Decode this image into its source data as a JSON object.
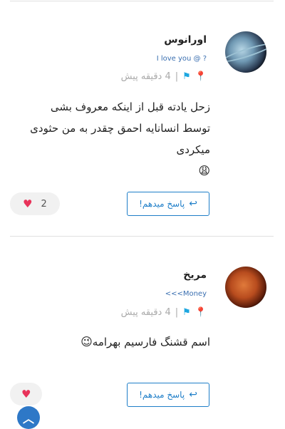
{
  "comments": [
    {
      "author": "اورانوس",
      "tagline": "I love you @ ?",
      "time": "4 دقیقه پیش",
      "text": "زحل یادته قبل از اینکه معروف بشی توسط انسانایه احمق چقدر به من حثودی میکردی",
      "emoji": "😩",
      "reply_label": "پاسخ میدهم!",
      "likes": "2",
      "avatar_icon": "uranus-planet-avatar"
    },
    {
      "author": "مریخ",
      "tagline": "<<<Money",
      "time": "4 دقیقه پیش",
      "text": "اسم قشنگ فارسیم بهرامه",
      "emoji": "😉",
      "reply_label": "پاسخ میدهم!",
      "likes": "",
      "avatar_icon": "mars-planet-avatar"
    }
  ],
  "colors": {
    "accent": "#1e7ec8",
    "heart": "#e8335a",
    "flag": "#1ea7e0",
    "scroll_button": "#2e78c7"
  }
}
